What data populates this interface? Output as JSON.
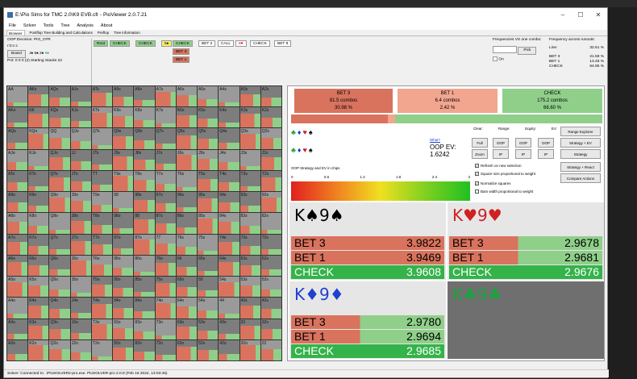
{
  "window": {
    "title": "E:\\Pio Sims for TMC 2.0\\K9 EVB.cfr - PioViewer 2.0.7.21"
  },
  "menu": [
    "File",
    "Solver",
    "Tools",
    "Tree",
    "Analysis",
    "About"
  ],
  "tabs": [
    "Browser",
    "Postflop Tree Building and Calculations",
    "Preflop",
    "Tree information"
  ],
  "left": {
    "decision": "OOP Decision:  PIO_CFR",
    "line": "r:0:c:c",
    "board_label": "Board",
    "board_cards": [
      "J♠",
      "5♠",
      "2♠",
      "9♠"
    ],
    "pot": "Pot: 0 0 0 (2) Starting Stacks 22"
  },
  "tree": {
    "row1": [
      "Root",
      "CHECK",
      "CHECK",
      "5♠",
      "CHECK",
      "BET 2",
      "CALL",
      "8♥",
      "CHECK",
      "BET 8"
    ],
    "row2": [
      "BET 3",
      "BET 1"
    ]
  },
  "freq": {
    "title": "Frequencies VS one combo:",
    "pick": "Pick",
    "on": "On",
    "runouts_title": "Frequency across runouts:",
    "line_label": "Line:",
    "line_val": "32.51 %",
    "rows": [
      [
        "BET 3",
        "21.59 %"
      ],
      [
        "BET 1",
        "13.46 %"
      ],
      [
        "CHECK",
        "64.95 %"
      ]
    ]
  },
  "actions": [
    {
      "name": "BET 3",
      "combos": "81.5 combos",
      "pct": "30.98 %",
      "color": "#d9735e"
    },
    {
      "name": "BET 1",
      "combos": "6.4 combos",
      "pct": "2.42 %",
      "color": "#f2a690"
    },
    {
      "name": "CHECK",
      "combos": "175.2 combos",
      "pct": "66.60 %",
      "color": "#8fcf8a"
    }
  ],
  "suits_row1": [
    "♣",
    "♦",
    "♥",
    "♠"
  ],
  "suits_row2": [
    "♣",
    "♦",
    "♥",
    "♠"
  ],
  "ev": {
    "what": "What?",
    "label": "OOP EV:",
    "value": "1.6242"
  },
  "mini_headers": [
    "Clear:",
    "Range:",
    "Equity:",
    "EV:"
  ],
  "mini_buttons": [
    [
      "Full",
      "OOP",
      "OOP",
      "OOP"
    ],
    [
      "Zoom",
      "IP",
      "IP",
      "IP"
    ]
  ],
  "wide_buttons": [
    "Range Explorer",
    "Strategy + EV",
    "Strategy",
    "Strategy + React",
    "Compare Actions"
  ],
  "checks": [
    "Refresh on new selection",
    "Square size proportional to weight",
    "Normalize squares",
    "Bars width proportional to weight"
  ],
  "scale": {
    "title": "OOP Strategy and EV in chips",
    "ticks": [
      "0",
      "0.6",
      "1.2",
      "1.8",
      "2.4",
      "3"
    ]
  },
  "quads": [
    {
      "rank1": "K",
      "suit1": "♠",
      "rank2": "9",
      "suit2": "♠",
      "color": "#000",
      "rows": [
        [
          "BET 3",
          "3.9822"
        ],
        [
          "BET 1",
          "3.9469"
        ],
        [
          "CHECK",
          "3.9608"
        ]
      ]
    },
    {
      "rank1": "K",
      "suit1": "♥",
      "rank2": "9",
      "suit2": "♥",
      "color": "#d02020",
      "rows": [
        [
          "BET 3",
          "2.9678"
        ],
        [
          "BET 1",
          "2.9681"
        ],
        [
          "CHECK",
          "2.9676"
        ]
      ]
    },
    {
      "rank1": "K",
      "suit1": "♦",
      "rank2": "9",
      "suit2": "♦",
      "color": "#2040d0",
      "rows": [
        [
          "BET 3",
          "2.9780"
        ],
        [
          "BET 1",
          "2.9694"
        ],
        [
          "CHECK",
          "2.9685"
        ]
      ]
    },
    {
      "rank1": "K",
      "suit1": "♣",
      "rank2": "9",
      "suit2": "♣",
      "color": "#20a040",
      "rows": []
    }
  ],
  "status": "Solver: Connected to: .\\PioSOLVER2-pro.exe. PioSOLVER-pro 2.0.8 (Feb 16 2022, 13:03:45)",
  "ranks": [
    "A",
    "K",
    "Q",
    "J",
    "T",
    "9",
    "8",
    "7",
    "6",
    "5",
    "4",
    "3",
    "2"
  ]
}
